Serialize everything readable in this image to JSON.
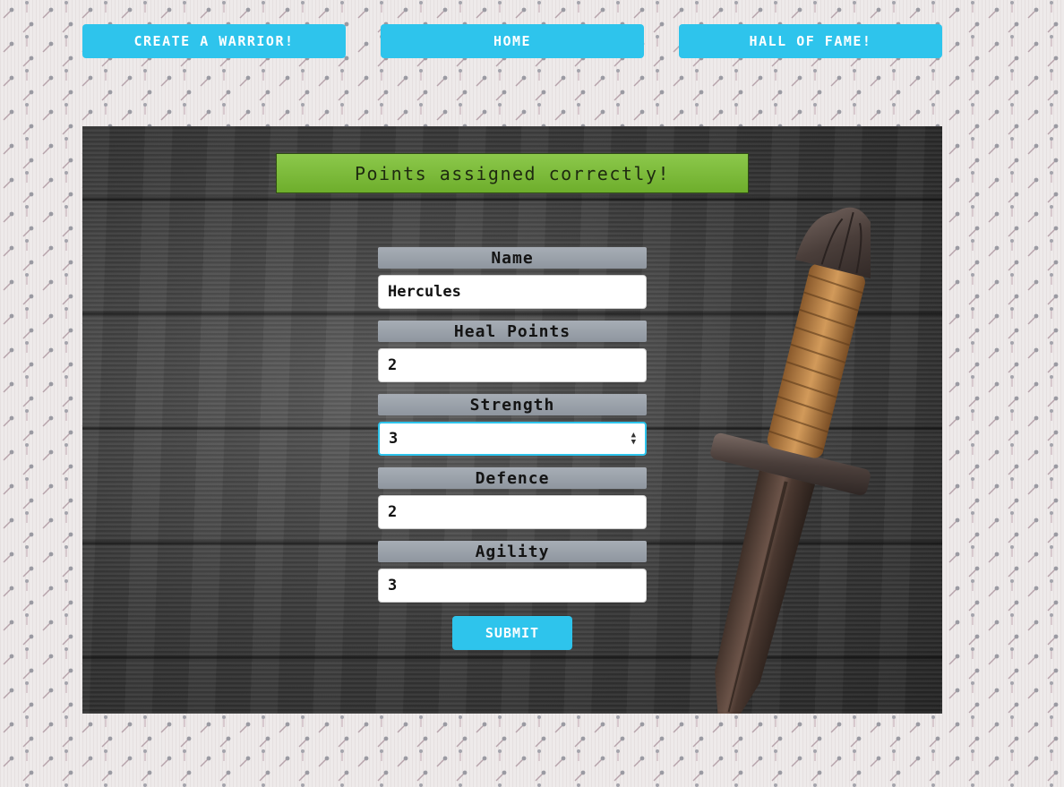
{
  "nav": {
    "create_label": "CREATE A WARRIOR!",
    "home_label": "HOME",
    "hall_label": "HALL OF FAME!"
  },
  "message": {
    "text": "Points assigned correctly!"
  },
  "form": {
    "fields": [
      {
        "label": "Name",
        "value": "Hercules"
      },
      {
        "label": "Heal Points",
        "value": "2"
      },
      {
        "label": "Strength",
        "value": "3"
      },
      {
        "label": "Defence",
        "value": "2"
      },
      {
        "label": "Agility",
        "value": "3"
      }
    ],
    "submit_label": "SUBMIT"
  },
  "colors": {
    "accent": "#2ec4ec",
    "success": "#7bbd38",
    "label_bg": "#9aa1aa"
  },
  "icons": {
    "background_pattern": "lollipop-pattern",
    "illustration": "sword-image",
    "spinner": "spinner-arrows-icon"
  }
}
